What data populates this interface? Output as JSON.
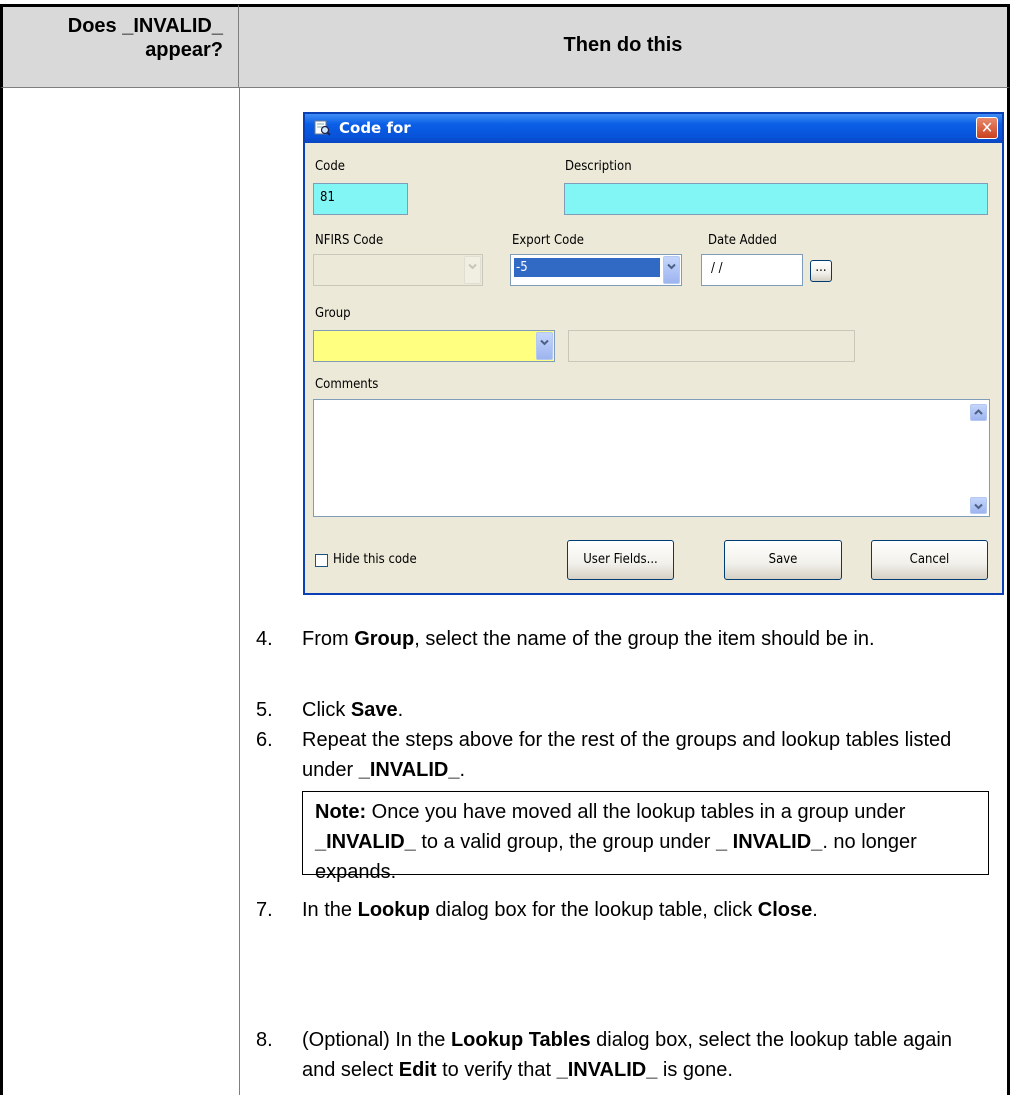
{
  "table": {
    "col1_header": "Does _INVALID_ appear?",
    "col2_header": "Then do this"
  },
  "dialog": {
    "title": "Code for",
    "close_symbol": "✕",
    "code_label": "Code",
    "code_value": "81",
    "description_label": "Description",
    "description_value": "",
    "nfirs_label": "NFIRS Code",
    "export_label": "Export Code",
    "export_value": "-5",
    "date_label": "Date Added",
    "date_value": "/ /",
    "date_button": "...",
    "group_label": "Group",
    "comments_label": "Comments",
    "hide_label": "Hide this code",
    "user_fields_button": "User Fields...",
    "save_button": "Save",
    "cancel_button": "Cancel",
    "colors": {
      "required_field": "#82f5f5",
      "group_field": "#ffff80",
      "title_bar": "#0a5fe6"
    }
  },
  "steps": [
    {
      "number": "4.",
      "parts": [
        {
          "t": "From "
        },
        {
          "t": "Group",
          "b": true
        },
        {
          "t": ", select the name of the group the item should be in."
        }
      ]
    },
    {
      "number": "5.",
      "parts": [
        {
          "t": "Click "
        },
        {
          "t": "Save",
          "b": true
        },
        {
          "t": "."
        }
      ]
    },
    {
      "number": "6.",
      "parts": [
        {
          "t": "Repeat the steps above for the rest of the groups and lookup tables listed under "
        },
        {
          "t": "_INVALID_",
          "b": true
        },
        {
          "t": "."
        }
      ]
    },
    {
      "number": "7.",
      "parts": [
        {
          "t": "In the "
        },
        {
          "t": "Lookup",
          "b": true
        },
        {
          "t": " dialog box for the lookup table, click "
        },
        {
          "t": "Close",
          "b": true
        },
        {
          "t": "."
        }
      ]
    },
    {
      "number": "8.",
      "parts": [
        {
          "t": "(Optional) In the "
        },
        {
          "t": "Lookup Tables",
          "b": true
        },
        {
          "t": " dialog box, select the lookup table again and select "
        },
        {
          "t": "Edit",
          "b": true
        },
        {
          "t": " to verify that "
        },
        {
          "t": "_INVALID_",
          "b": true
        },
        {
          "t": " is gone."
        }
      ]
    }
  ],
  "note": {
    "parts": [
      {
        "t": "Note:",
        "b": true
      },
      {
        "t": " Once you have moved all the lookup tables in a group under "
      },
      {
        "t": "_INVALID_",
        "b": true
      },
      {
        "t": " to a valid group, the group under "
      },
      {
        "t": "_ INVALID_",
        "b": true
      },
      {
        "t": ". no longer expands."
      }
    ]
  }
}
